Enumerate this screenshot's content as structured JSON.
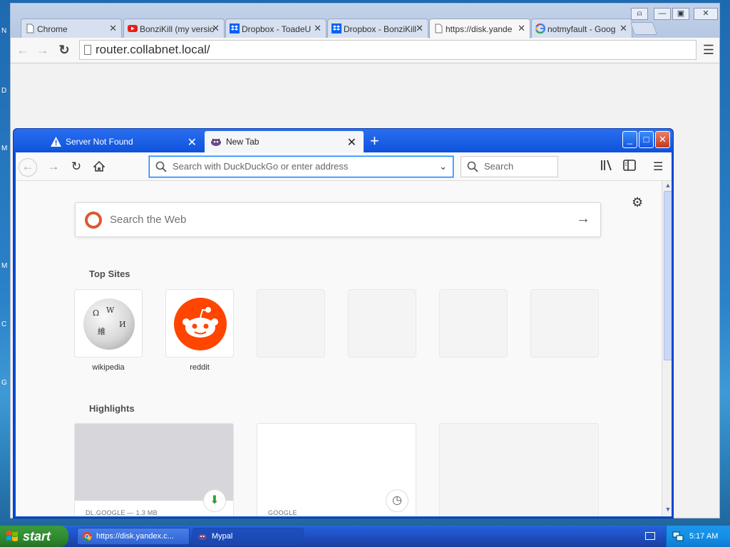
{
  "desktop": {
    "edge_letters": [
      "N",
      "D",
      "M",
      "M",
      "C",
      "G"
    ]
  },
  "chrome": {
    "tabs": [
      {
        "label": "Chrome",
        "icon": "page-icon"
      },
      {
        "label": "BonziKill (my versio",
        "icon": "youtube-icon"
      },
      {
        "label": "Dropbox - ToadeU",
        "icon": "dropbox-icon"
      },
      {
        "label": "Dropbox - BonziKill",
        "icon": "dropbox-icon"
      },
      {
        "label": "https://disk.yande",
        "icon": "page-icon"
      },
      {
        "label": "notmyfault - Goog",
        "icon": "google-icon"
      }
    ],
    "tab_close": "✕",
    "address": "router.collabnet.local/",
    "menu_icon": "☰"
  },
  "firefox": {
    "tabs": [
      {
        "label": "Server Not Found",
        "icon": "warning-icon"
      },
      {
        "label": "New Tab",
        "icon": "bonzi-icon"
      }
    ],
    "new_tab_symbol": "+",
    "urlbar_placeholder": "Search with DuckDuckGo or enter address",
    "search_placeholder": "Search",
    "page": {
      "web_search_placeholder": "Search the Web",
      "top_sites_title": "Top Sites",
      "top_sites": [
        {
          "label": "wikipedia"
        },
        {
          "label": "reddit"
        },
        {
          "label": ""
        },
        {
          "label": ""
        },
        {
          "label": ""
        },
        {
          "label": ""
        }
      ],
      "highlights_title": "Highlights",
      "highlights": [
        {
          "source": "DL.GOOGLE — 1.3 MB",
          "badge": "download-icon"
        },
        {
          "source": "GOOGLE",
          "badge": "clock-icon"
        },
        {
          "source": "",
          "badge": ""
        }
      ]
    }
  },
  "taskbar": {
    "start_label": "start",
    "buttons": [
      {
        "label": "https://disk.yandex.c...",
        "icon": "chrome-icon"
      },
      {
        "label": "Mypal",
        "icon": "bonzi-icon"
      }
    ],
    "clock": "5:17 AM"
  },
  "colors": {
    "xp_blue": "#0a4ad8",
    "start_green": "#2f8a2f",
    "reddit_orange": "#ff4500",
    "ddg_orange": "#de5833",
    "firefox_accent": "#0a84ff"
  }
}
